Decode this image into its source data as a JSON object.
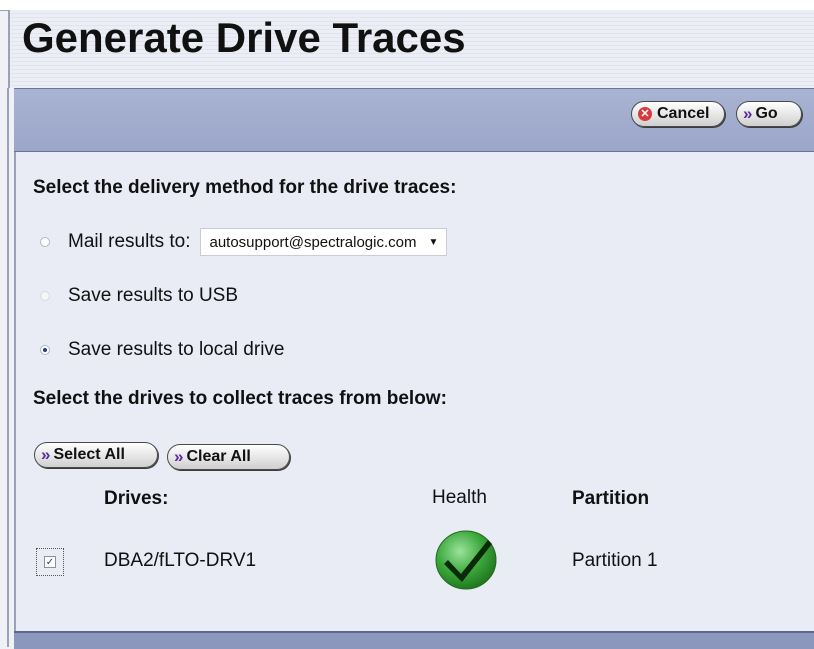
{
  "page": {
    "title": "Generate Drive Traces"
  },
  "toolbar": {
    "cancel_label": "Cancel",
    "go_label": "Go"
  },
  "delivery": {
    "heading": "Select the delivery method for the drive traces:",
    "mail_label": "Mail results to:",
    "mail_selected": "autosupport@spectralogic.com",
    "usb_label": "Save results to USB",
    "local_label": "Save results to local drive",
    "selected_option": "local"
  },
  "drives_section": {
    "heading": "Select the drives to collect traces from below:",
    "select_all_label": "Select All",
    "clear_all_label": "Clear All"
  },
  "table": {
    "columns": [
      "Drives:",
      "Health",
      "Partition"
    ],
    "rows": [
      {
        "drive": "DBA2/fLTO-DRV1",
        "health": "ok",
        "partition": "Partition 1",
        "checked": true
      }
    ]
  },
  "colors": {
    "toolbar": "#a9b3d3",
    "panel": "#e9ecf5",
    "health_ok": "#3aa63a",
    "chevron": "#5a2a9c"
  }
}
